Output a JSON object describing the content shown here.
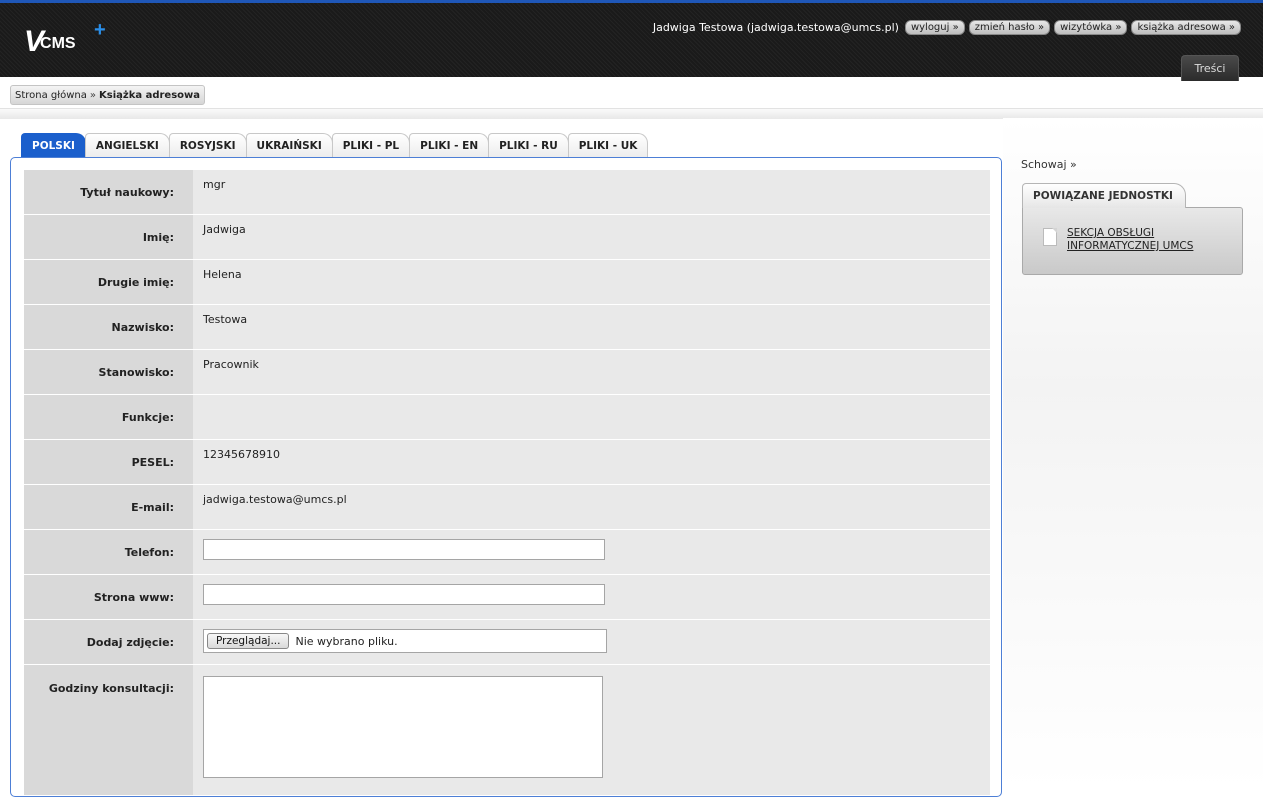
{
  "header": {
    "logo_v": "V",
    "logo_cms": "CMS",
    "logo_plus": "+",
    "user": "Jadwiga Testowa (jadwiga.testowa@umcs.pl)",
    "buttons": [
      "wyloguj »",
      "zmień hasło »",
      "wizytówka »",
      "książka adresowa »"
    ],
    "main_tab": "Treści",
    "accent": "#1b5fcc"
  },
  "breadcrumb": {
    "home": "Strona główna",
    "sep": "»",
    "current": "Książka adresowa"
  },
  "lang_tabs": [
    "POLSKI",
    "ANGIELSKI",
    "ROSYJSKI",
    "UKRAIŃSKI",
    "PLIKI - PL",
    "PLIKI - EN",
    "PLIKI - RU",
    "PLIKI - UK"
  ],
  "active_tab": "POLSKI",
  "form": {
    "title_label": "Tytuł naukowy:",
    "title_value": "mgr",
    "name_label": "Imię:",
    "name_value": "Jadwiga",
    "second_name_label": "Drugie imię:",
    "second_name_value": "Helena",
    "surname_label": "Nazwisko:",
    "surname_value": "Testowa",
    "position_label": "Stanowisko:",
    "position_value": "Pracownik",
    "functions_label": "Funkcje:",
    "functions_value": "",
    "pesel_label": "PESEL:",
    "pesel_value": "12345678910",
    "email_label": "E-mail:",
    "email_value": "jadwiga.testowa@umcs.pl",
    "phone_label": "Telefon:",
    "phone_value": "",
    "www_label": "Strona www:",
    "www_value": "",
    "photo_label": "Dodaj zdjęcie:",
    "photo_button": "Przeglądaj...",
    "photo_status": "Nie wybrano pliku.",
    "hours_label": "Godziny konsultacji:",
    "hours_value": ""
  },
  "sidebar": {
    "hide": "Schowaj »",
    "box_title": "POWIĄZANE JEDNOSTKI",
    "unit": "SEKCJA OBSŁUGI INFORMATYCZNEJ UMCS"
  }
}
